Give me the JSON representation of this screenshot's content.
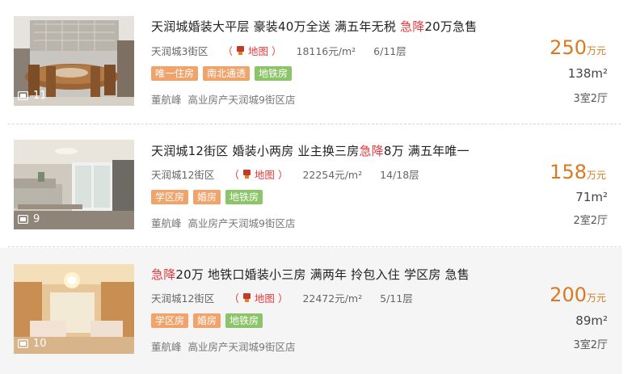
{
  "colors": {
    "price": "#d97a20",
    "hot": "#e4393c",
    "tag_orange": "#f0a36b",
    "tag_green": "#8cc46a"
  },
  "listings": [
    {
      "photo_count": "11",
      "title_pre": "天润城婚装大平层 豪装40万全送 满五年无税 ",
      "title_hot": "急降",
      "title_post": "20万急售",
      "community": "天润城3街区",
      "map_label": "地图",
      "unit_price": "18116元/m²",
      "floor": "6/11层",
      "tags": [
        "唯一住房",
        "南北通透",
        "地铁房"
      ],
      "agent_name": "董航峰",
      "agency": "高业房产天润城9街区店",
      "price": "250",
      "price_unit": "万元",
      "area": "138m²",
      "layout": "3室2厅"
    },
    {
      "photo_count": "9",
      "title_pre": "天润城12街区 婚装小两房 业主换三房",
      "title_hot": "急降",
      "title_post": "8万 满五年唯一",
      "community": "天润城12街区",
      "map_label": "地图",
      "unit_price": "22254元/m²",
      "floor": "14/18层",
      "tags": [
        "学区房",
        "婚房",
        "地铁房"
      ],
      "agent_name": "董航峰",
      "agency": "高业房产天润城9街区店",
      "price": "158",
      "price_unit": "万元",
      "area": "71m²",
      "layout": "2室2厅"
    },
    {
      "photo_count": "10",
      "title_pre": "",
      "title_hot": "急降",
      "title_post": "20万 地铁口婚装小三房 满两年 拎包入住 学区房 急售",
      "community": "天润城12街区",
      "map_label": "地图",
      "unit_price": "22472元/m²",
      "floor": "5/11层",
      "tags": [
        "学区房",
        "婚房",
        "地铁房"
      ],
      "agent_name": "董航峰",
      "agency": "高业房产天润城9街区店",
      "price": "200",
      "price_unit": "万元",
      "area": "89m²",
      "layout": "3室2厅"
    }
  ]
}
